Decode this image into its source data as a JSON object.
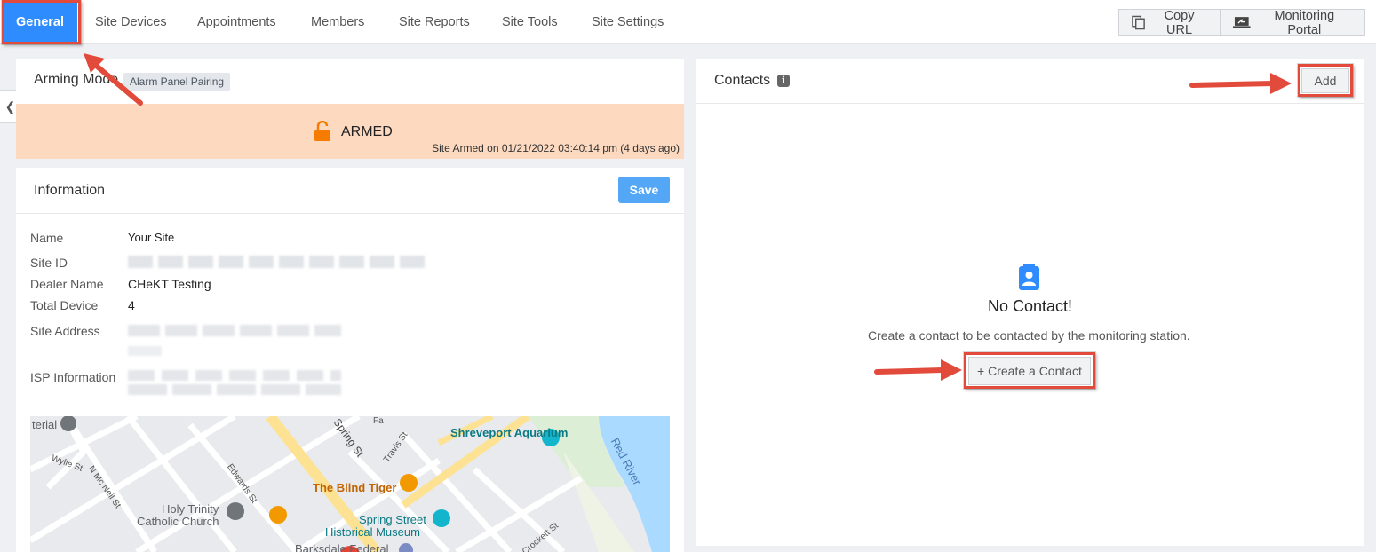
{
  "nav": {
    "tabs": [
      {
        "label": "General",
        "active": true
      },
      {
        "label": "Site Devices"
      },
      {
        "label": "Appointments"
      },
      {
        "label": "Members"
      },
      {
        "label": "Site Reports"
      },
      {
        "label": "Site Tools"
      },
      {
        "label": "Site Settings"
      }
    ],
    "copy_url_label": "Copy URL",
    "monitoring_portal_label": "Monitoring Portal",
    "copy_icon": "copy-icon",
    "portal_icon": "laptop-share-icon"
  },
  "arming": {
    "title": "Arming Mode",
    "badge": "Alarm Panel Pairing",
    "status": "ARMED",
    "status_icon": "unlocked-padlock-icon",
    "status_color": "#f57c00",
    "band_color": "#fdd9bf",
    "armed_on": "Site Armed on 01/21/2022 03:40:14 pm (4 days ago)"
  },
  "information": {
    "title": "Information",
    "save_label": "Save",
    "fields": {
      "name_label": "Name",
      "name_value": "Your Site",
      "site_id_label": "Site ID",
      "dealer_label": "Dealer Name",
      "dealer_value": "CHeKT Testing",
      "total_device_label": "Total Device",
      "total_device_value": "4",
      "address_label": "Site Address",
      "isp_label": "ISP Information"
    }
  },
  "map": {
    "labels": {
      "aquarium": "Shreveport Aquarium",
      "red_river": "Red River",
      "blind_tiger": "The Blind Tiger",
      "holy_trinity_1": "Holy Trinity",
      "holy_trinity_2": "Catholic Church",
      "museum_1": "Spring Street",
      "museum_2": "Historical Museum",
      "spring_st": "Spring St",
      "travis_st": "Travis St",
      "wylie_st": "Wylie St",
      "mcneil_st": "N Mc Neil St",
      "edwards_st": "Edwards St",
      "crockett_st": "Crockett St",
      "terial": "terial",
      "fannin": "Fa",
      "barksdale": "Barksdale Federal"
    }
  },
  "contacts": {
    "title": "Contacts",
    "info_icon": "info-icon",
    "add_label": "Add",
    "empty_icon": "contact-book-icon",
    "empty_title": "No Contact!",
    "empty_desc": "Create a contact to be contacted by the monitoring station.",
    "create_label": "+ Create a Contact",
    "accent": "#2f8cff"
  },
  "annotation_color": "#e24a3b"
}
